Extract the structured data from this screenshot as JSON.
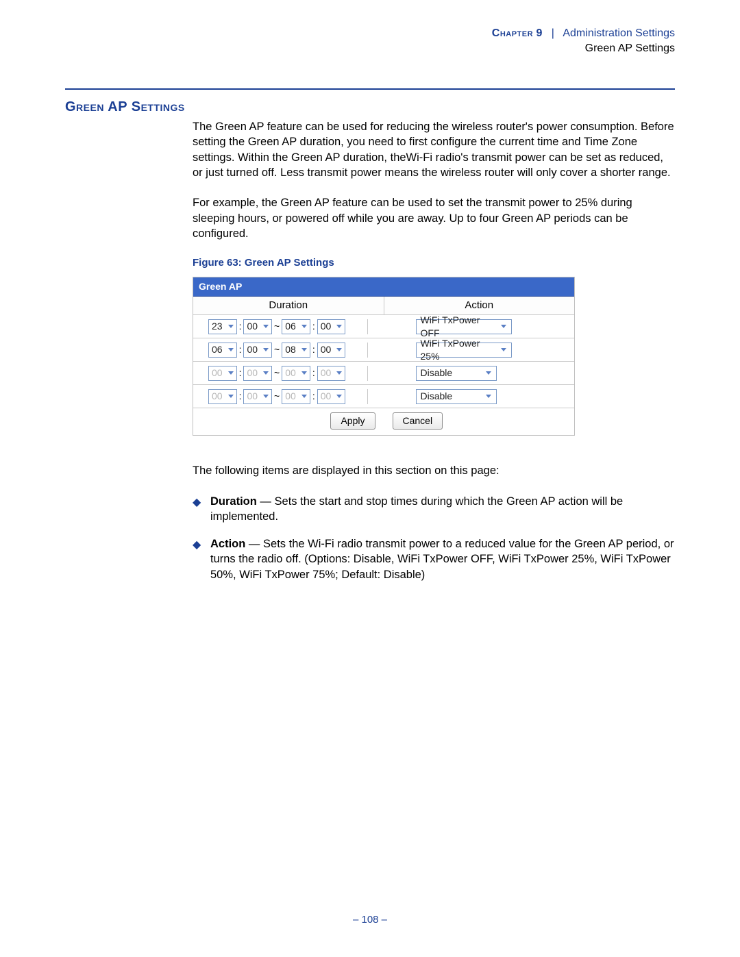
{
  "header": {
    "chapter_label": "Chapter",
    "chapter_number": "9",
    "divider": "|",
    "line1": "Administration Settings",
    "line2": "Green AP Settings"
  },
  "section_title": "Green AP Settings",
  "paragraphs": {
    "p1": "The Green AP feature can be used for reducing the wireless router's power consumption. Before setting the Green AP duration, you need to first configure the current time and Time Zone settings. Within the Green AP duration, theWi-Fi radio's transmit power can be set as reduced, or just turned off. Less transmit power means the wireless router will only cover a shorter range.",
    "p2": "For example, the Green AP feature can be used to set the transmit power to 25% during sleeping hours, or powered off while you are away. Up to four Green AP periods can be configured."
  },
  "figure_caption": "Figure 63:  Green AP Settings",
  "screenshot": {
    "panel_title": "Green AP",
    "col_duration": "Duration",
    "col_action": "Action",
    "colon": ":",
    "tilde": "~",
    "rows": [
      {
        "h1": "23",
        "m1": "00",
        "h2": "06",
        "m2": "00",
        "action": "WiFi TxPower OFF",
        "enabled": true
      },
      {
        "h1": "06",
        "m1": "00",
        "h2": "08",
        "m2": "00",
        "action": "WiFi TxPower 25%",
        "enabled": true
      },
      {
        "h1": "00",
        "m1": "00",
        "h2": "00",
        "m2": "00",
        "action": "Disable",
        "enabled": false
      },
      {
        "h1": "00",
        "m1": "00",
        "h2": "00",
        "m2": "00",
        "action": "Disable",
        "enabled": false
      }
    ],
    "apply": "Apply",
    "cancel": "Cancel"
  },
  "items_intro": "The following items are displayed in this section on this page:",
  "items": [
    {
      "label": "Duration",
      "text": " — Sets the start and stop times during which the Green AP action will be implemented."
    },
    {
      "label": "Action",
      "text": " — Sets the Wi-Fi radio transmit power to a reduced value for the Green AP period, or turns the radio off. (Options: Disable, WiFi TxPower OFF, WiFi TxPower 25%, WiFi TxPower 50%, WiFi TxPower 75%; Default: Disable)"
    }
  ],
  "page_number": "–  108  –"
}
